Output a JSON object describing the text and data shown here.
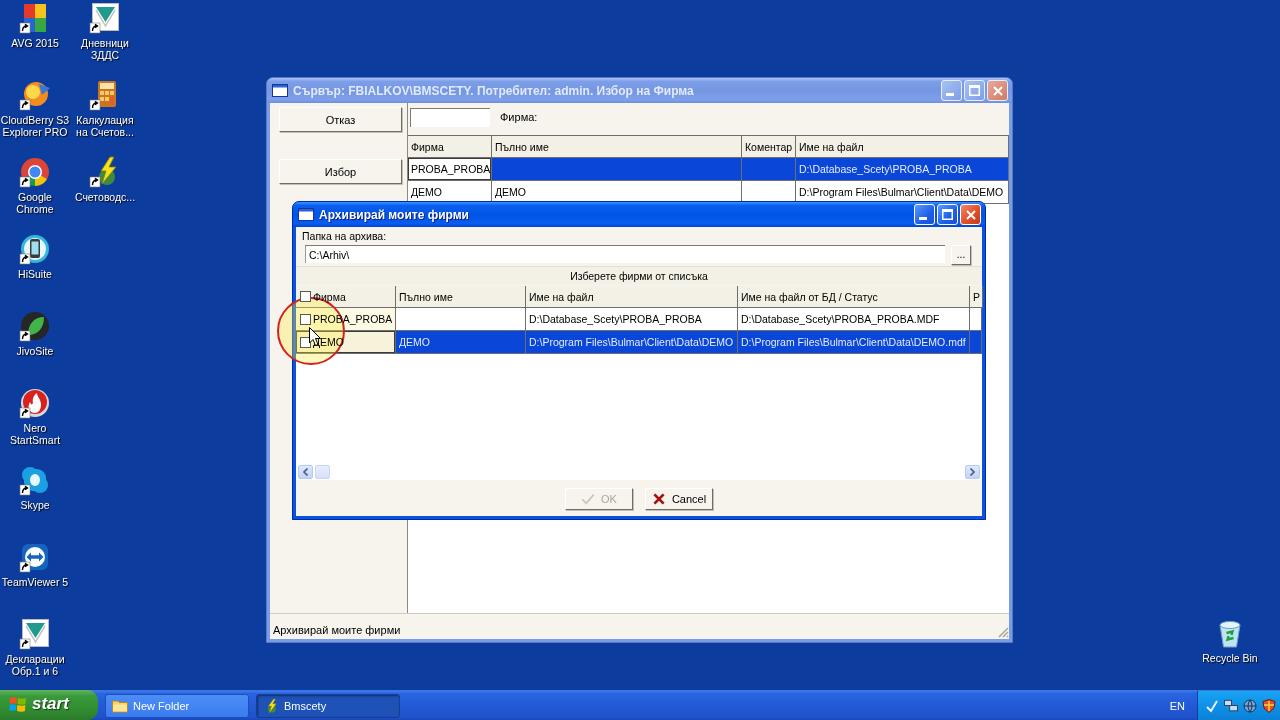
{
  "desktop_icons": [
    {
      "label": "AVG 2015",
      "kind": "color-squares"
    },
    {
      "label": "CloudBerry S3 Explorer PRO",
      "kind": "swirl"
    },
    {
      "label": "Google Chrome",
      "kind": "ring"
    },
    {
      "label": "HiSuite",
      "kind": "phone"
    },
    {
      "label": "JivoSite",
      "kind": "leaf"
    },
    {
      "label": "Nero StartSmart",
      "kind": "flame"
    },
    {
      "label": "Skype",
      "kind": "cloud"
    },
    {
      "label": "TeamViewer 5",
      "kind": "arrows"
    },
    {
      "label": "Декларации Обр.1 и 6",
      "kind": "triangle"
    },
    {
      "label": "Дневници ЗДДС",
      "kind": "triangle"
    },
    {
      "label": "Калкулация на Счетов...",
      "kind": "calculator"
    },
    {
      "label": "Счетоводс...",
      "kind": "lightning"
    }
  ],
  "recycle_bin": {
    "label": "Recycle Bin"
  },
  "main_window": {
    "title": "Сървър: FBIALKOV\\BMSCETY. Потребител: admin. Избор на Фирма",
    "active": false,
    "buttons": [
      "Отказ",
      "Избор"
    ],
    "filter": {
      "label": "Фирма:"
    },
    "table": {
      "columns": [
        "Фирма",
        "Пълно име",
        "Коментар",
        "Име на файл"
      ],
      "rows": [
        {
          "company": "PROBA_PROBA",
          "file_name": "D:\\Database_Scety\\PROBA_PROBA",
          "selected": true
        },
        {
          "company": "ДЕМО",
          "full_name": "ДЕМО",
          "file_name": "D:\\Program Files\\Bulmar\\Client\\Data\\DEMO",
          "selected": false
        }
      ]
    },
    "status_bar": "Архивирай моите фирми"
  },
  "dialog": {
    "title": "Архивирай моите фирми",
    "active": true,
    "folder": {
      "label": "Папка на архива:",
      "value": "C:\\Arhiv\\",
      "browse_button": "..."
    },
    "list_caption": "Изберете фирми от списъка",
    "table": {
      "columns": [
        "Фирма",
        "Пълно име",
        "Име на файл",
        "Име на файл от БД / Статус",
        "Р"
      ],
      "header_checkbox": {
        "checked": false
      },
      "rows": [
        {
          "checked": false,
          "selected": false,
          "company": "PROBA_PROBA",
          "file_name": "D:\\Database_Scety\\PROBA_PROBA",
          "db_file_status": "D:\\Database_Scety\\PROBA_PROBA.MDF"
        },
        {
          "checked": false,
          "selected": true,
          "company": "ДЕМО",
          "full_name": "ДЕМО",
          "file_name": "D:\\Program Files\\Bulmar\\Client\\Data\\DEMO",
          "db_file_status": "D:\\Program Files\\Bulmar\\Client\\Data\\DEMO.mdf"
        }
      ]
    },
    "buttons": [
      {
        "label": "OK",
        "kind": "ok",
        "disabled": true
      },
      {
        "label": "Cancel",
        "kind": "cancel",
        "disabled": false
      }
    ]
  },
  "taskbar": {
    "start_button": "start",
    "tasks": [
      {
        "label": "New Folder",
        "kind": "folder",
        "selected": false
      },
      {
        "label": "Bmscety",
        "kind": "app",
        "selected": true
      }
    ],
    "language": "EN"
  }
}
